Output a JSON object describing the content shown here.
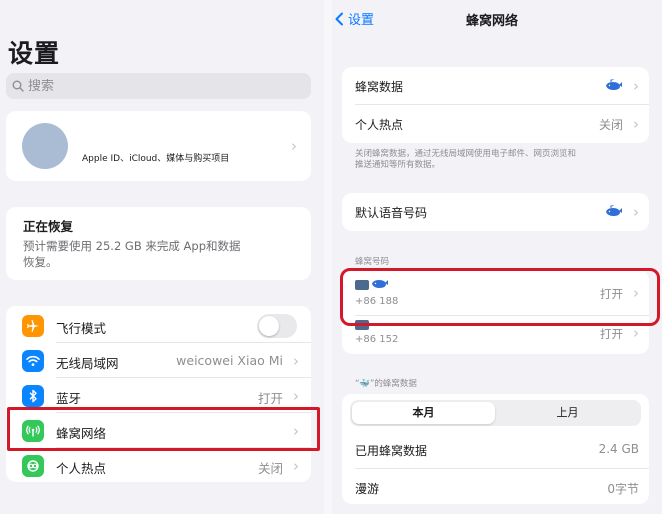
{
  "left": {
    "title": "设置",
    "search_placeholder": "搜索",
    "apple_id_text": "Apple ID、iCloud、媒体与购买项目",
    "restore": {
      "title": "正在恢复",
      "description_line1": "预计需要使用 25.2 GB 来完成 App和数据",
      "description_line2": "恢复。"
    },
    "items": [
      {
        "label": "飞行模式",
        "value": "",
        "icon": "airplane-icon",
        "color": "#ff9500",
        "toggle": false
      },
      {
        "label": "无线局域网",
        "value": "weicowei Xiao Mi",
        "icon": "wifi-icon",
        "color": "#0a84ff"
      },
      {
        "label": "蓝牙",
        "value": "打开",
        "icon": "bluetooth-icon",
        "color": "#0a84ff"
      },
      {
        "label": "蜂窝网络",
        "value": "",
        "icon": "cellular-antenna-icon",
        "color": "#34c759"
      },
      {
        "label": "个人热点",
        "value": "关闭",
        "icon": "hotspot-icon",
        "color": "#34c759"
      }
    ]
  },
  "right": {
    "back_label": "设置",
    "title": "蜂窝网络",
    "cellular_data_label": "蜂窝数据",
    "hotspot_label": "个人热点",
    "hotspot_value": "关闭",
    "footnote_line1": "关闭蜂窝数据，通过无线局域网使用电子邮件、网页浏览和",
    "footnote_line2": "推送通知等所有数据。",
    "default_voice_label": "默认语音号码",
    "numbers_header": "蜂窝号码",
    "sim1": {
      "number": "+86 188",
      "value": "打开"
    },
    "sim2": {
      "number": "+86 152",
      "value": "打开"
    },
    "usage_header": "“🐳”的蜂窝数据",
    "seg_current": "本月",
    "seg_last": "上月",
    "used_label": "已用蜂窝数据",
    "used_value": "2.4 GB",
    "roaming_label": "漫游",
    "roaming_value": "0字节"
  },
  "colors": {
    "accent": "#0a7aff",
    "highlight": "#d3182a"
  }
}
